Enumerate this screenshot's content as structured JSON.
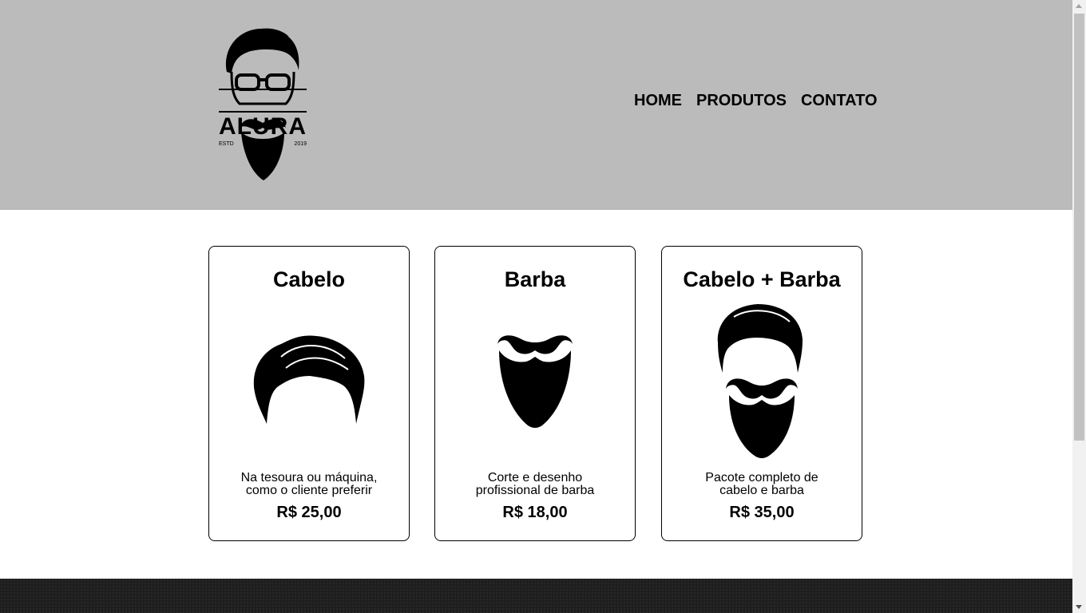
{
  "brand": {
    "name": "ALURA",
    "estd_label": "ESTD",
    "year": "2019"
  },
  "nav": {
    "items": [
      {
        "label": "HOME"
      },
      {
        "label": "PRODUTOS"
      },
      {
        "label": "CONTATO"
      }
    ]
  },
  "products": [
    {
      "title": "Cabelo",
      "icon": "hair-icon",
      "description": "Na tesoura ou máquina, como o cliente preferir",
      "price": "R$ 25,00"
    },
    {
      "title": "Barba",
      "icon": "beard-icon",
      "description": "Corte e desenho profissional de barba",
      "price": "R$ 18,00"
    },
    {
      "title": "Cabelo + Barba",
      "icon": "hair-and-beard-icon",
      "description": "Pacote completo de cabelo e barba",
      "price": "R$ 35,00"
    }
  ],
  "colors": {
    "header_bg": "#bbbbbb",
    "footer_bg": "#1e1e1e",
    "text": "#000000"
  }
}
